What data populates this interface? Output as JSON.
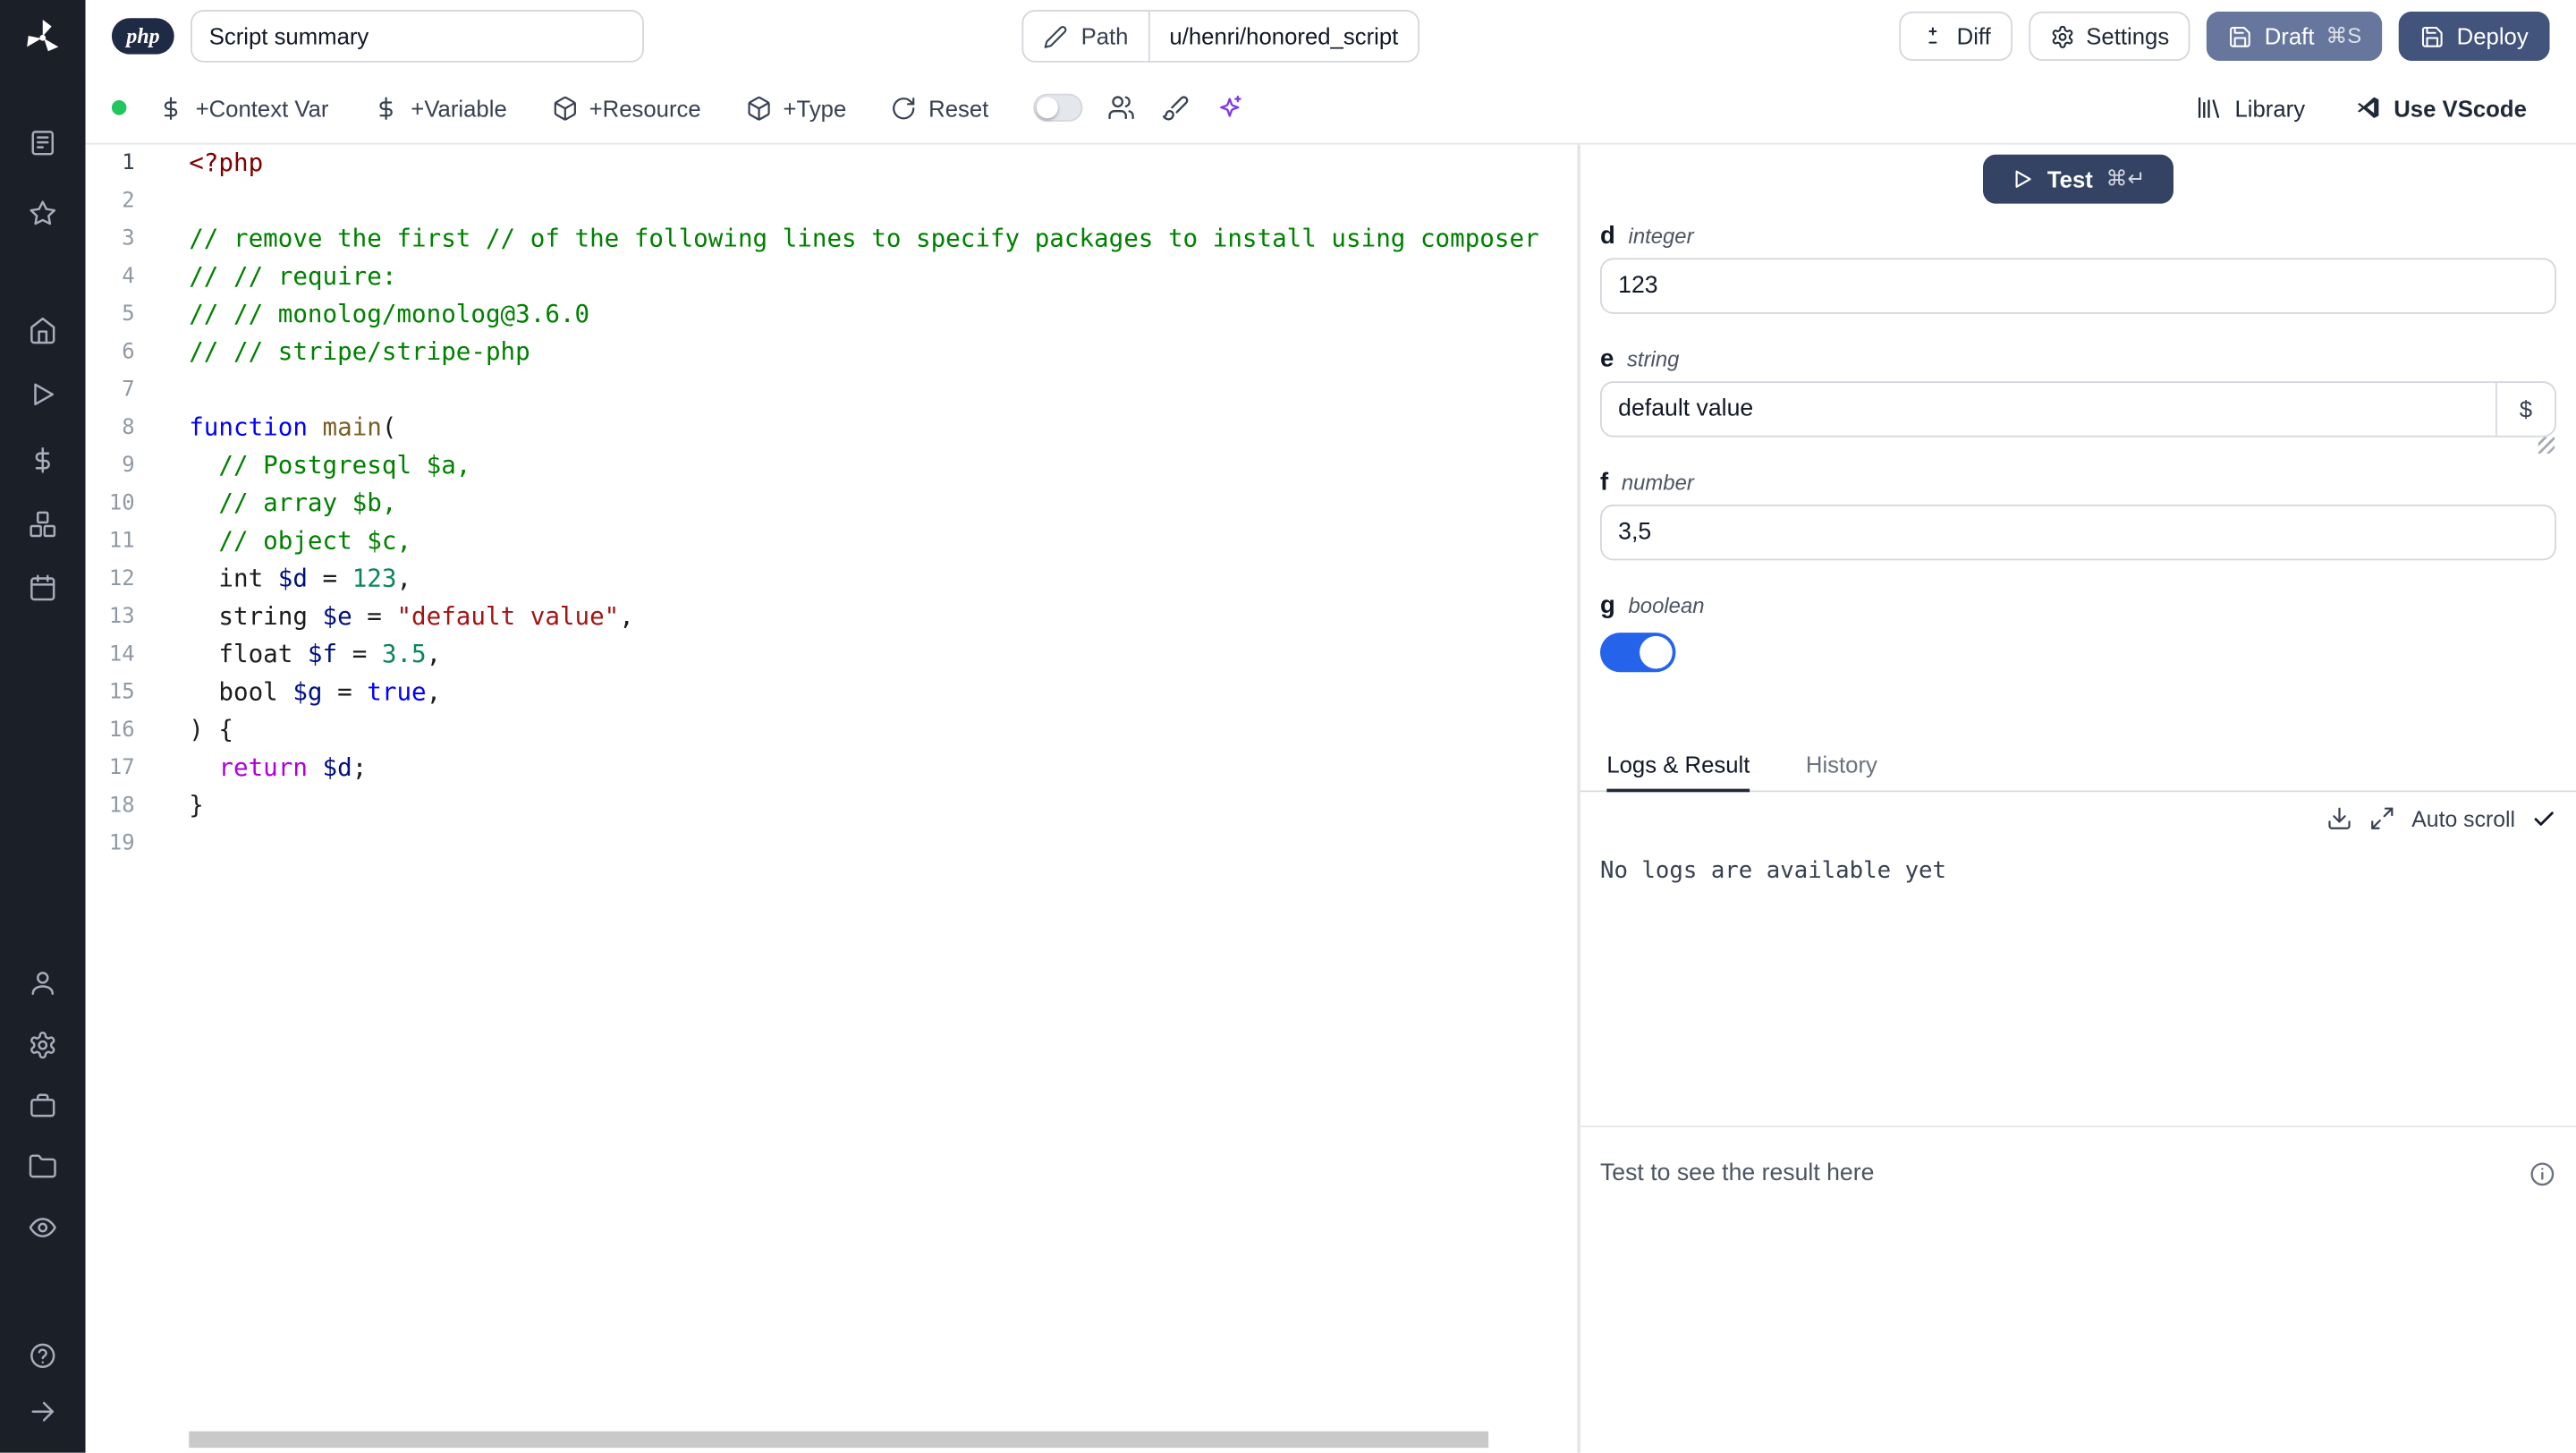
{
  "colors": {
    "sidebar-bg": "#1b1f28",
    "status-green": "#22c55e",
    "accent-blue": "#2563eb",
    "draft-bg": "#66769c",
    "deploy-bg": "#42547c",
    "test-bg": "#344364",
    "badge-bg": "#1f2a44",
    "ai-purple": "#7c3aed",
    "tok-comment": "#008000",
    "tok-keyword": "#0000ff",
    "tok-variable": "#001080",
    "tok-number": "#098658",
    "tok-string": "#a31515",
    "tok-metatag": "#800000",
    "tok-function": "#795e26",
    "tok-control": "#af00db"
  },
  "sidebar": {
    "icons": [
      "windmill-logo",
      "notebook",
      "star",
      "home",
      "play",
      "dollar",
      "boxes",
      "calendar",
      "user",
      "settings",
      "briefcase",
      "folder",
      "eye",
      "help",
      "expand-arrow"
    ]
  },
  "header": {
    "language_badge": "php",
    "summary_value": "Script summary",
    "path_label": "Path",
    "path_value": "u/henri/honored_script",
    "diff_label": "Diff",
    "settings_label": "Settings",
    "draft_label": "Draft",
    "draft_shortcut": "⌘S",
    "deploy_label": "Deploy"
  },
  "toolbar": {
    "context_var_label": "+Context Var",
    "variable_label": "+Variable",
    "resource_label": "+Resource",
    "type_label": "+Type",
    "reset_label": "Reset",
    "library_label": "Library",
    "vscode_label": "Use VScode"
  },
  "editor": {
    "language": "php",
    "lines": [
      {
        "n": 1,
        "t": [
          [
            "tag",
            "<?php"
          ]
        ]
      },
      {
        "n": 2,
        "t": []
      },
      {
        "n": 3,
        "t": [
          [
            "comment",
            "// remove the first // of the following lines to specify packages to install using composer"
          ]
        ]
      },
      {
        "n": 4,
        "t": [
          [
            "comment",
            "// // require:"
          ]
        ]
      },
      {
        "n": 5,
        "t": [
          [
            "comment",
            "// // monolog/monolog@3.6.0"
          ]
        ]
      },
      {
        "n": 6,
        "t": [
          [
            "comment",
            "// // stripe/stripe-php"
          ]
        ]
      },
      {
        "n": 7,
        "t": []
      },
      {
        "n": 8,
        "t": [
          [
            "kw",
            "function"
          ],
          [
            "plain",
            " "
          ],
          [
            "fn",
            "main"
          ],
          [
            "plain",
            "("
          ]
        ]
      },
      {
        "n": 9,
        "t": [
          [
            "plain",
            "  "
          ],
          [
            "comment",
            "// Postgresql $a,"
          ]
        ]
      },
      {
        "n": 10,
        "t": [
          [
            "plain",
            "  "
          ],
          [
            "comment",
            "// array $b,"
          ]
        ]
      },
      {
        "n": 11,
        "t": [
          [
            "plain",
            "  "
          ],
          [
            "comment",
            "// object $c,"
          ]
        ]
      },
      {
        "n": 12,
        "t": [
          [
            "plain",
            "  int "
          ],
          [
            "var",
            "$d"
          ],
          [
            "plain",
            " = "
          ],
          [
            "num",
            "123"
          ],
          [
            "plain",
            ","
          ]
        ]
      },
      {
        "n": 13,
        "t": [
          [
            "plain",
            "  string "
          ],
          [
            "var",
            "$e"
          ],
          [
            "plain",
            " = "
          ],
          [
            "str",
            "\"default value\""
          ],
          [
            "plain",
            ","
          ]
        ]
      },
      {
        "n": 14,
        "t": [
          [
            "plain",
            "  float "
          ],
          [
            "var",
            "$f"
          ],
          [
            "plain",
            " = "
          ],
          [
            "num",
            "3.5"
          ],
          [
            "plain",
            ","
          ]
        ]
      },
      {
        "n": 15,
        "t": [
          [
            "plain",
            "  bool "
          ],
          [
            "var",
            "$g"
          ],
          [
            "plain",
            " = "
          ],
          [
            "kw",
            "true"
          ],
          [
            "plain",
            ","
          ]
        ]
      },
      {
        "n": 16,
        "t": [
          [
            "plain",
            ") {"
          ]
        ]
      },
      {
        "n": 17,
        "t": [
          [
            "plain",
            "  "
          ],
          [
            "ctrl",
            "return"
          ],
          [
            "plain",
            " "
          ],
          [
            "var",
            "$d"
          ],
          [
            "plain",
            ";"
          ]
        ]
      },
      {
        "n": 18,
        "t": [
          [
            "plain",
            "}"
          ]
        ]
      },
      {
        "n": 19,
        "t": []
      }
    ]
  },
  "right_panel": {
    "test_label": "Test",
    "test_shortcut": "⌘↵",
    "fields": [
      {
        "name": "d",
        "type": "integer",
        "kind": "input",
        "value": "123"
      },
      {
        "name": "e",
        "type": "string",
        "kind": "input",
        "value": "default value",
        "suffix_button": "$"
      },
      {
        "name": "f",
        "type": "number",
        "kind": "input",
        "value": "3,5"
      },
      {
        "name": "g",
        "type": "boolean",
        "kind": "toggle",
        "value": true
      }
    ],
    "tabs": [
      {
        "label": "Logs & Result",
        "active": true
      },
      {
        "label": "History",
        "active": false
      }
    ],
    "auto_scroll_label": "Auto scroll",
    "logs_empty_text": "No logs are available yet",
    "result_placeholder": "Test to see the result here"
  }
}
